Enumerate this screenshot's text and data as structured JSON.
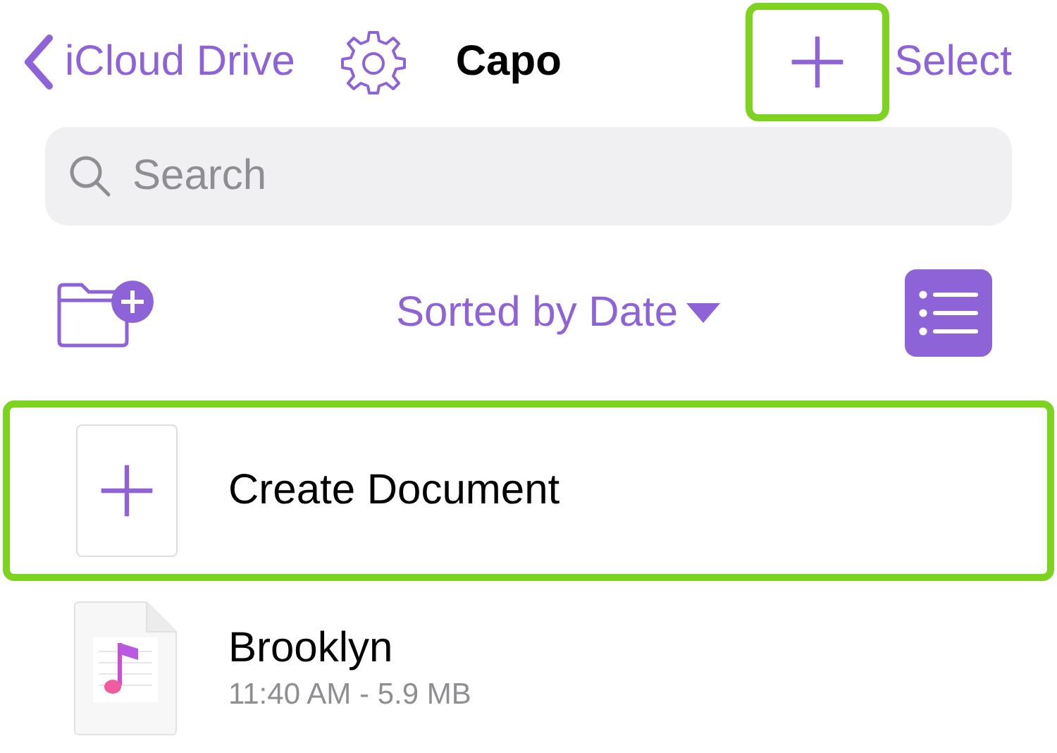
{
  "nav": {
    "back_label": "iCloud Drive",
    "title": "Capo",
    "add_button": {
      "highlighted": true
    },
    "action": "Select"
  },
  "search": {
    "placeholder": "Search"
  },
  "toolbar": {
    "sort_label": "Sorted by Date",
    "list_view": {
      "selected": true
    }
  },
  "items": [
    {
      "kind": "create",
      "title": "Create Document",
      "highlighted": true
    },
    {
      "kind": "document",
      "title": "Brooklyn",
      "subtitle": "11:40 AM - 5.9 MB",
      "highlighted": false
    }
  ]
}
